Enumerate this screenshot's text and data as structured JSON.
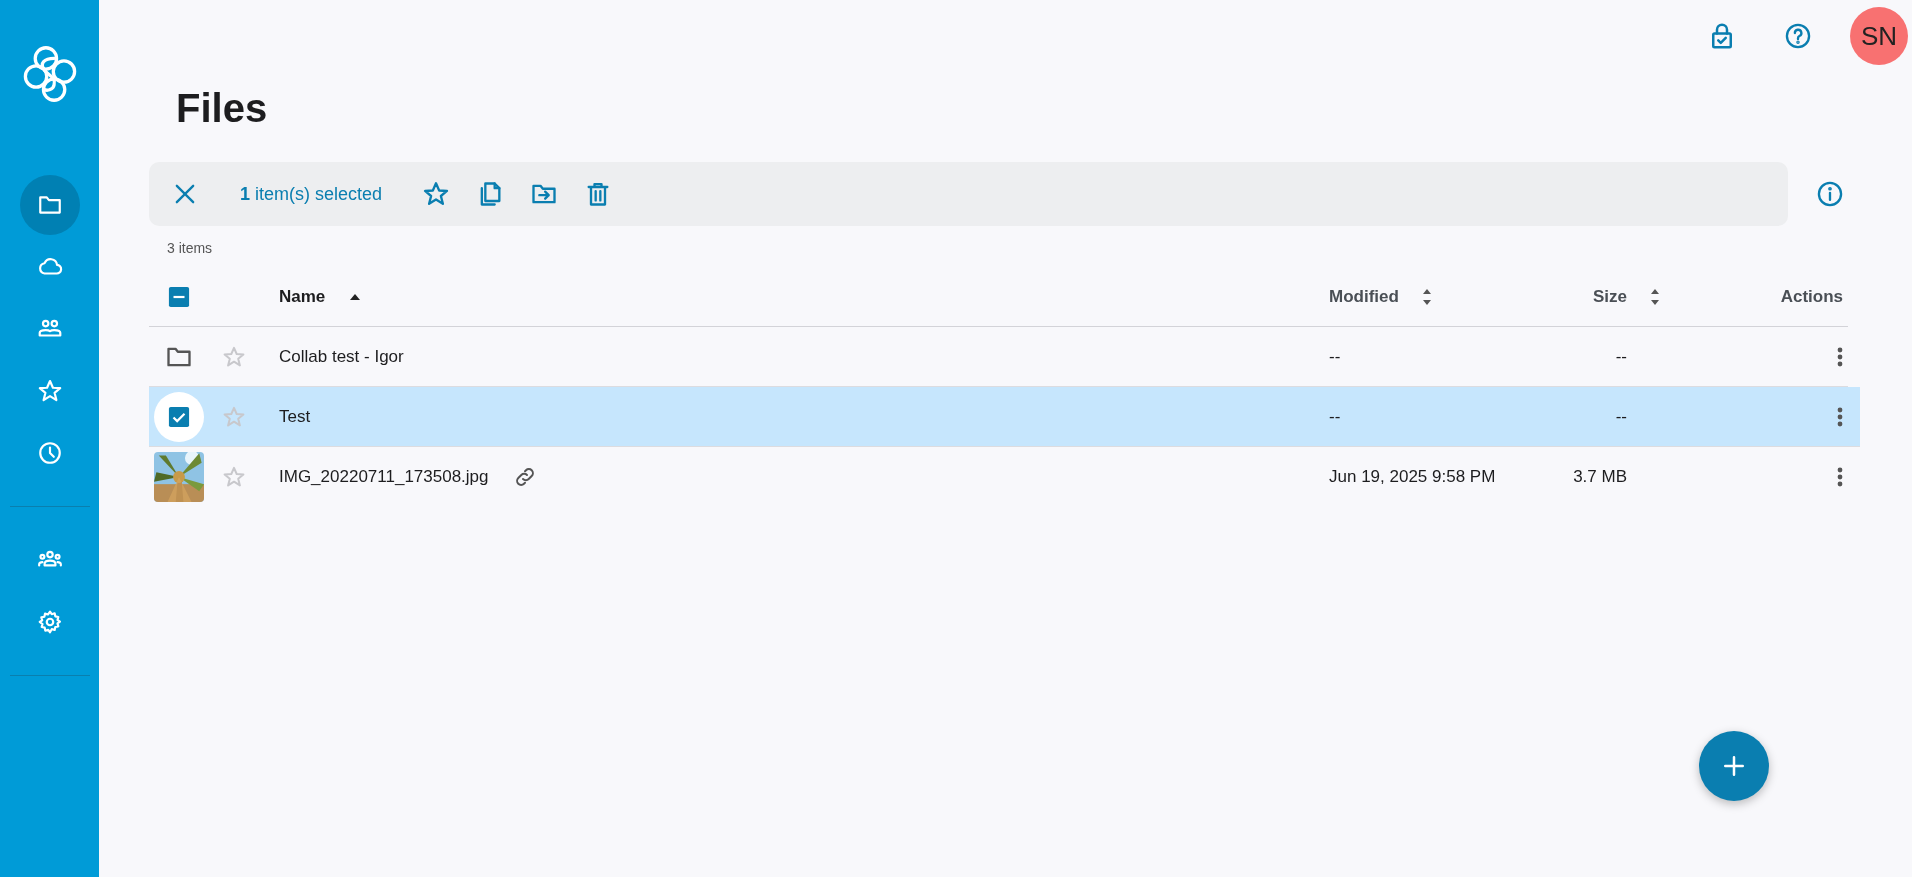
{
  "sidebar": {
    "nav": [
      {
        "kind": "files",
        "selected": true
      },
      {
        "kind": "cloud",
        "selected": false
      },
      {
        "kind": "shared",
        "selected": false
      },
      {
        "kind": "starred",
        "selected": false
      },
      {
        "kind": "recent",
        "selected": false
      },
      {
        "kind": "divider"
      },
      {
        "kind": "groups",
        "selected": false
      },
      {
        "kind": "settings",
        "selected": false
      },
      {
        "kind": "divider"
      }
    ]
  },
  "top_bar": {
    "avatar": {
      "initials": "SN",
      "color": "#f87171"
    }
  },
  "page": {
    "title": "Files"
  },
  "selection_toolbar": {
    "label": "**1** item(s) selected"
  },
  "items_count": "3 items",
  "table": {
    "header_checkbox": {
      "indeterminate": true
    },
    "columns": [
      {
        "label": "Name",
        "sorted": true
      },
      {
        "label": "Modified",
        "sorted": false
      },
      {
        "label": "Size",
        "sorted": false
      },
      {
        "label": "Actions"
      }
    ],
    "rows": [
      {
        "kind": "folder",
        "name": "Collab test - Igor",
        "starred": false,
        "selected": false,
        "shared": false,
        "modified": "--",
        "size": "--"
      },
      {
        "name": "Test",
        "starred": false,
        "selected": true,
        "shared": false,
        "modified": "--",
        "size": "--"
      },
      {
        "name": "IMG_20220711_173508.jpg",
        "starred": false,
        "selected": false,
        "shared": true,
        "modified": "Jun 19, 2025 9:58 PM",
        "size": "3.7 MB"
      }
    ]
  }
}
